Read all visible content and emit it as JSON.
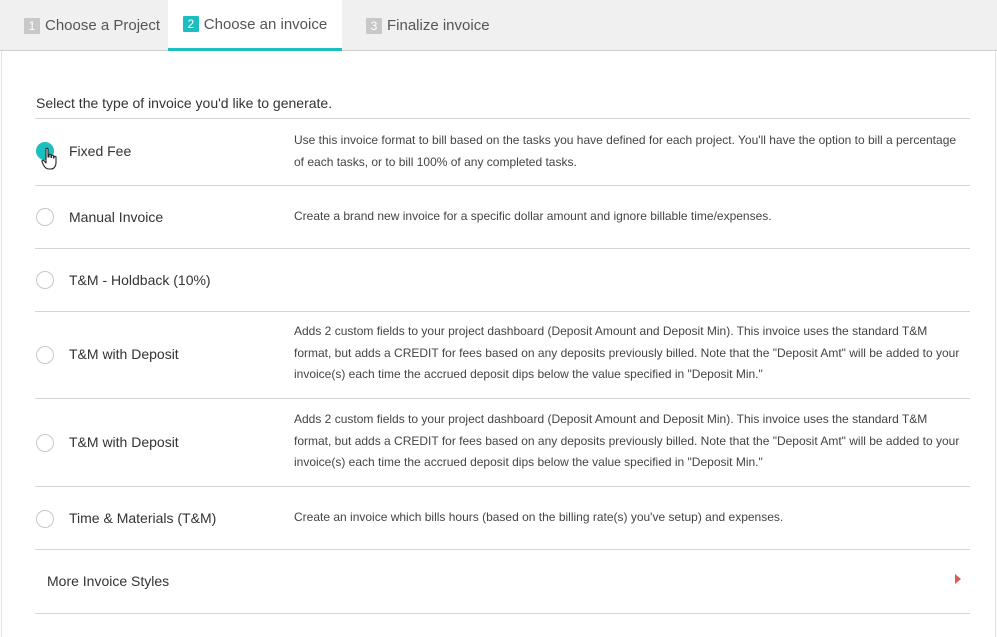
{
  "tabs": [
    {
      "num": "1",
      "label": "Choose a Project"
    },
    {
      "num": "2",
      "label": "Choose an invoice"
    },
    {
      "num": "3",
      "label": "Finalize invoice"
    }
  ],
  "prompt": "Select the type of invoice you'd like to generate.",
  "options": [
    {
      "label": "Fixed Fee",
      "desc": "Use this invoice format to bill based on the tasks you have defined for each project. You'll have the option to bill a percentage of each tasks, or to bill 100% of any completed tasks.",
      "selected": true
    },
    {
      "label": "Manual Invoice",
      "desc": "Create a brand new invoice for a specific dollar amount and ignore billable time/expenses.",
      "selected": false
    },
    {
      "label": "T&M - Holdback (10%)",
      "desc": "",
      "selected": false
    },
    {
      "label": "T&M with Deposit",
      "desc": "Adds 2 custom fields to your project dashboard (Deposit Amount and Deposit Min). This invoice uses the standard T&M format, but adds a CREDIT for fees based on any deposits previously billed. Note that the \"Deposit Amt\" will be added to your invoice(s) each time the accrued deposit dips below the value specified in \"Deposit Min.\"",
      "selected": false
    },
    {
      "label": "T&M with Deposit",
      "desc": "Adds 2 custom fields to your project dashboard (Deposit Amount and Deposit Min). This invoice uses the standard T&M format, but adds a CREDIT for fees based on any deposits previously billed. Note that the \"Deposit Amt\" will be added to your invoice(s) each time the accrued deposit dips below the value specified in \"Deposit Min.\"",
      "selected": false
    },
    {
      "label": "Time & Materials (T&M)",
      "desc": "Create an invoice which bills hours (based on the billing rate(s) you've setup) and expenses.",
      "selected": false
    }
  ],
  "more": {
    "label": "More Invoice Styles",
    "icon": "caret-right-icon"
  },
  "colors": {
    "accent": "#1bbfbf",
    "arrow": "#e05a4f"
  }
}
